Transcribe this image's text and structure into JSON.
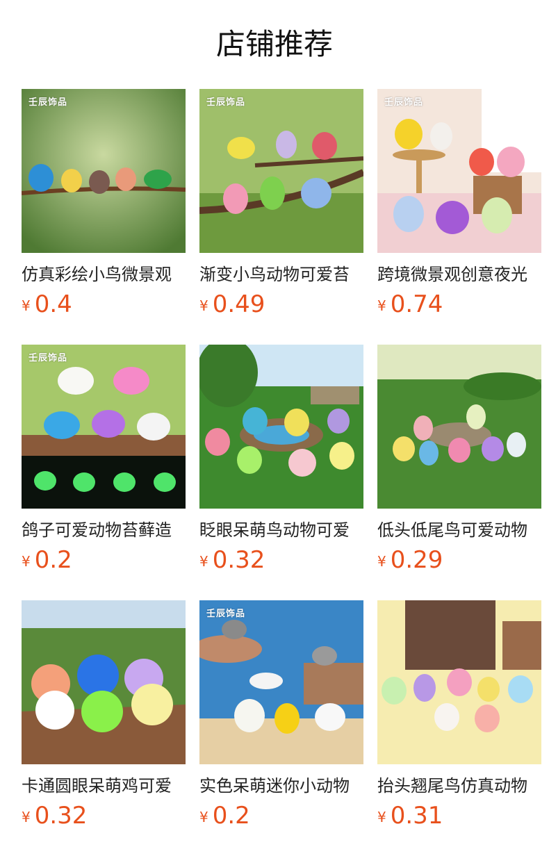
{
  "page_title": "店铺推荐",
  "currency_symbol": "¥",
  "brand_watermark": "壬辰饰品",
  "products": [
    {
      "name": "仿真彩绘小鸟微景观",
      "price": "0.4"
    },
    {
      "name": "渐变小鸟动物可爱苔",
      "price": "0.49"
    },
    {
      "name": "跨境微景观创意夜光",
      "price": "0.74"
    },
    {
      "name": "鸽子可爱动物苔藓造",
      "price": "0.2"
    },
    {
      "name": "眨眼呆萌鸟动物可爱",
      "price": "0.32"
    },
    {
      "name": "低头低尾鸟可爱动物",
      "price": "0.29"
    },
    {
      "name": "卡通圆眼呆萌鸡可爱",
      "price": "0.32"
    },
    {
      "name": "实色呆萌迷你小动物",
      "price": "0.2"
    },
    {
      "name": "抬头翘尾鸟仿真动物",
      "price": "0.31"
    }
  ],
  "colors": {
    "price": "#e8501c",
    "title": "#111111"
  }
}
